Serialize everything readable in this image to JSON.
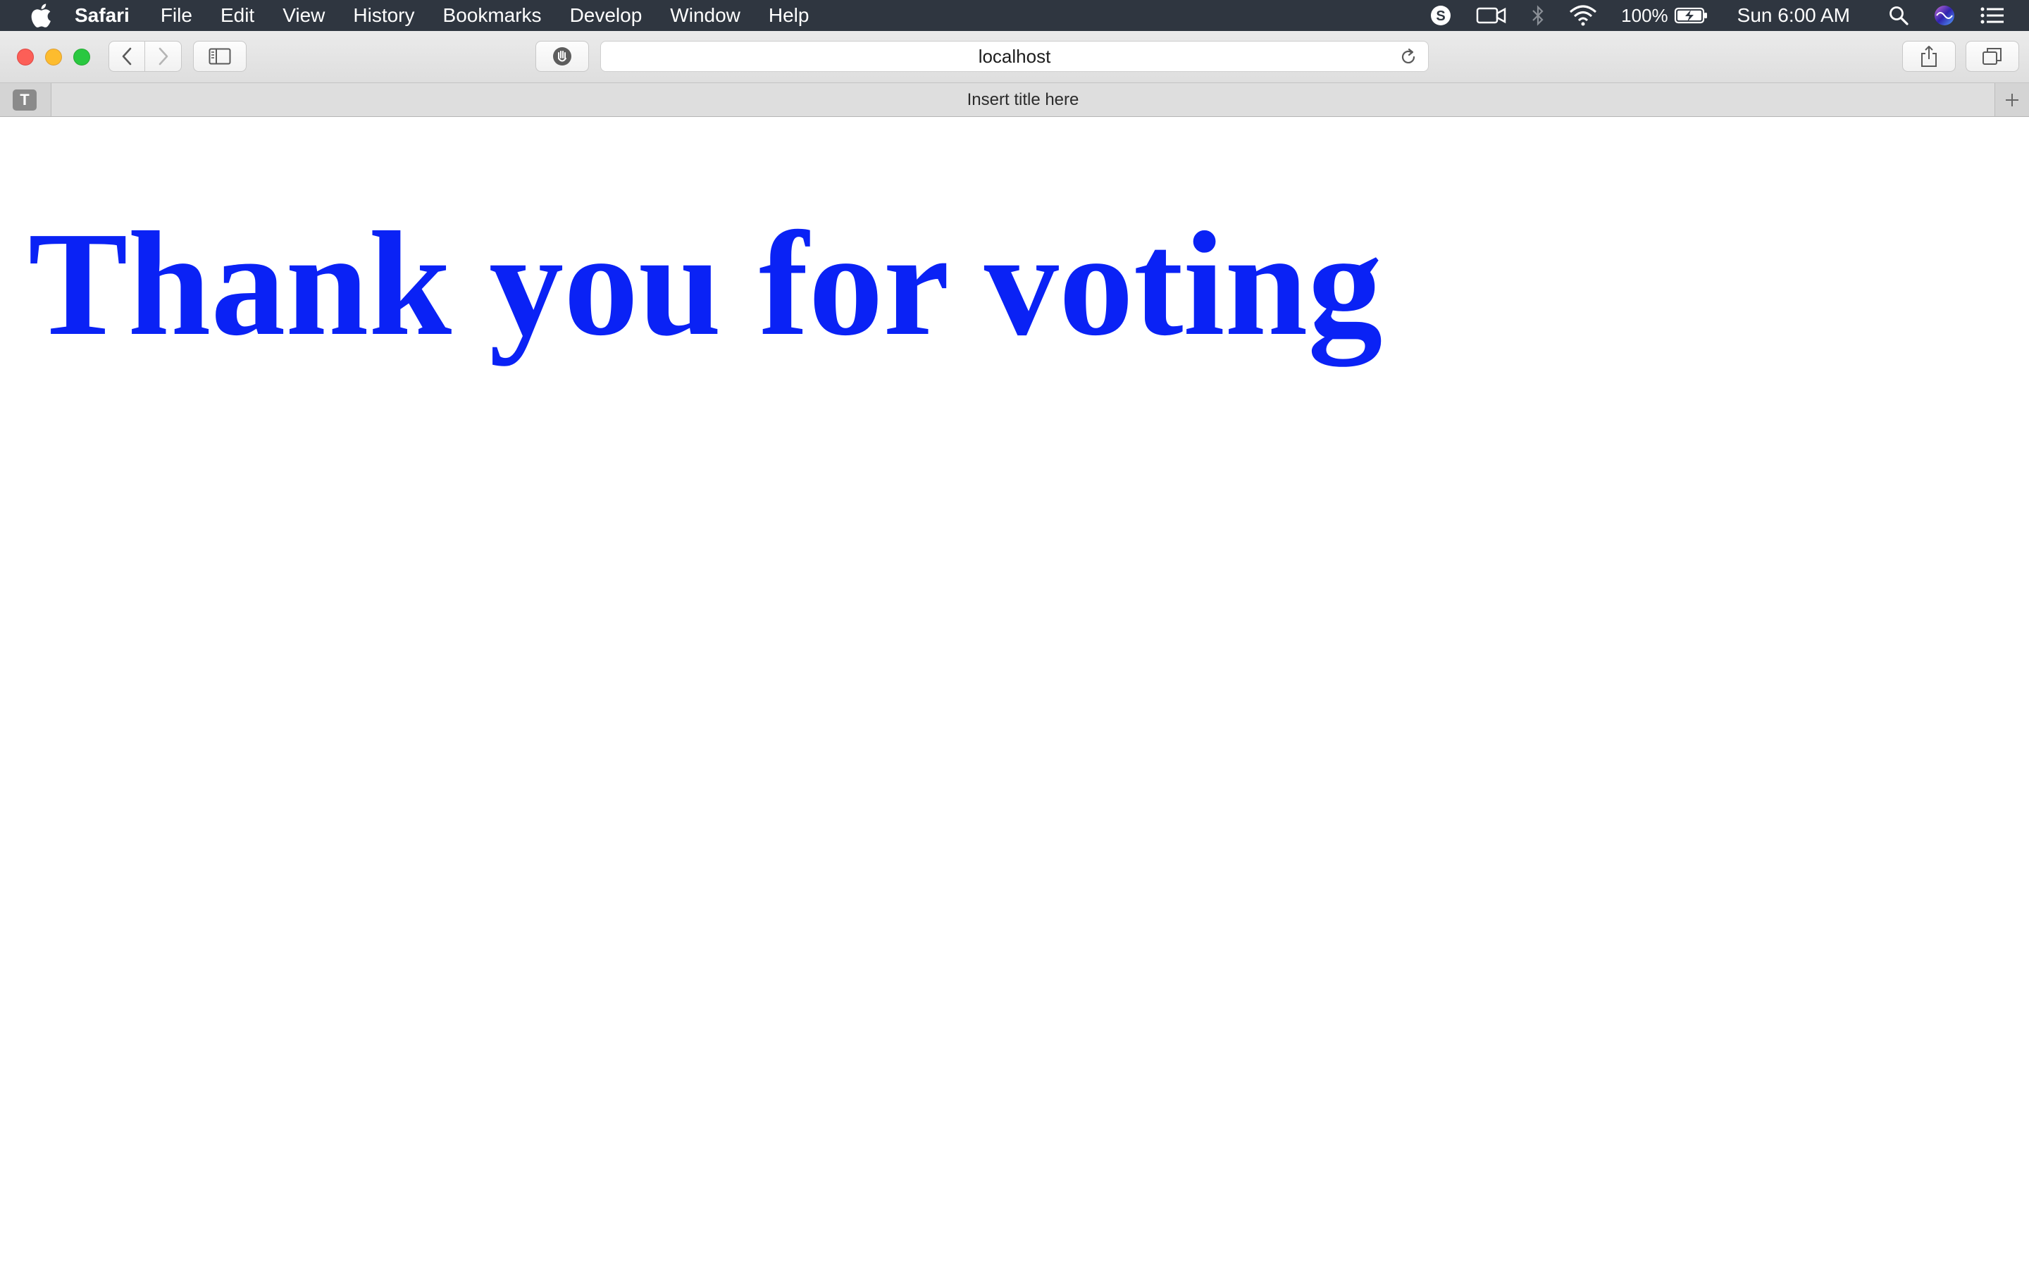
{
  "menubar": {
    "app_name": "Safari",
    "items": [
      "File",
      "Edit",
      "View",
      "History",
      "Bookmarks",
      "Develop",
      "Window",
      "Help"
    ],
    "status": {
      "battery_percent": "100%",
      "clock": "Sun 6:00 AM"
    },
    "icons": [
      "apple-icon",
      "skype-icon",
      "facetime-camera-icon",
      "bluetooth-icon",
      "wifi-icon",
      "battery-charging-icon",
      "spotlight-search-icon",
      "siri-icon",
      "notification-center-icon"
    ]
  },
  "toolbar": {
    "url": "localhost",
    "icons": [
      "back-icon",
      "forward-icon",
      "sidebar-icon",
      "privacy-shield-icon",
      "reload-icon",
      "share-icon",
      "tab-overview-icon"
    ]
  },
  "tabbar": {
    "favicon_letter": "T",
    "tab_title": "Insert title here",
    "new_tab_symbol": "+"
  },
  "page": {
    "heading": "Thank you for voting",
    "heading_color": "#0a22f5"
  }
}
